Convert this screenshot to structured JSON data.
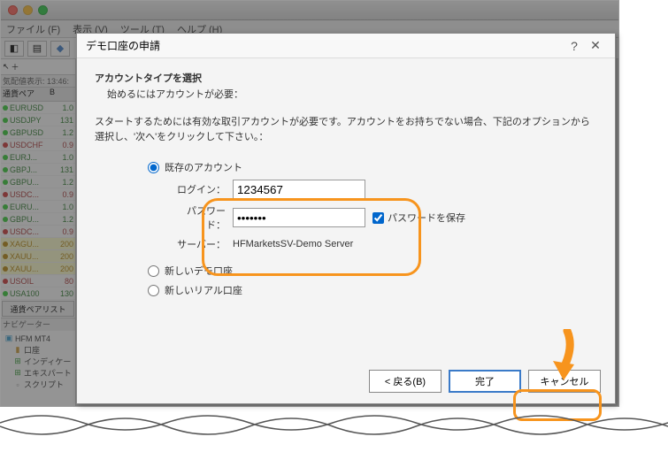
{
  "menu": {
    "file": "ファイル (F)",
    "view": "表示 (V)",
    "tool": "ツール (T)",
    "help": "ヘルプ (H)"
  },
  "priceHeader": "気配値表示: 13:46:",
  "mwHead": {
    "pair": "通貨ペア",
    "bid": "B"
  },
  "symbols": [
    {
      "s": "EURUSD",
      "p": "1.0",
      "c": "up"
    },
    {
      "s": "USDJPY",
      "p": "131",
      "c": "up"
    },
    {
      "s": "GBPUSD",
      "p": "1.2",
      "c": "up"
    },
    {
      "s": "USDCHF",
      "p": "0.9",
      "c": "down"
    },
    {
      "s": "EURJ...",
      "p": "1.0",
      "c": "up"
    },
    {
      "s": "GBPJ...",
      "p": "131",
      "c": "up"
    },
    {
      "s": "GBPU...",
      "p": "1.2",
      "c": "up"
    },
    {
      "s": "USDC...",
      "p": "0.9",
      "c": "down"
    },
    {
      "s": "EURU...",
      "p": "1.0",
      "c": "up"
    },
    {
      "s": "GBPU...",
      "p": "1.2",
      "c": "up"
    },
    {
      "s": "USDC...",
      "p": "0.9",
      "c": "down"
    },
    {
      "s": "XAGU...",
      "p": "200",
      "c": "gold"
    },
    {
      "s": "XAUU...",
      "p": "200",
      "c": "gold"
    },
    {
      "s": "XAUU...",
      "p": "200",
      "c": "gold"
    },
    {
      "s": "USOIL",
      "p": "80",
      "c": "down"
    },
    {
      "s": "USA100",
      "p": "130",
      "c": "up"
    }
  ],
  "pairListTab": "通貨ペアリスト",
  "nav": {
    "title": "ナビゲーター",
    "root": "HFM MT4",
    "items": [
      "口座",
      "インディケー",
      "エキスパート",
      "スクリプト"
    ]
  },
  "dialog": {
    "title": "デモ口座の申請",
    "heading": "アカウントタイプを選択",
    "subheading": "始めるにはアカウントが必要：",
    "desc": "スタートするためには有効な取引アカウントが必要です。アカウントをお持ちでない場合、下記のオプションから選択し、'次へ'をクリックして下さい。：",
    "optExisting": "既存のアカウント",
    "loginLabel": "ログイン：",
    "loginValue": "1234567",
    "passwordLabel": "パスワード：",
    "passwordValue": "•••••••",
    "savePassword": "パスワードを保存",
    "serverLabel": "サーバー：",
    "serverValue": "HFMarketsSV-Demo Server",
    "optNewDemo": "新しいデモ口座",
    "optNewReal": "新しいリアル口座",
    "btnBack": "< 戻る(B)",
    "btnFinish": "完了",
    "btnCancel": "キャンセル"
  }
}
